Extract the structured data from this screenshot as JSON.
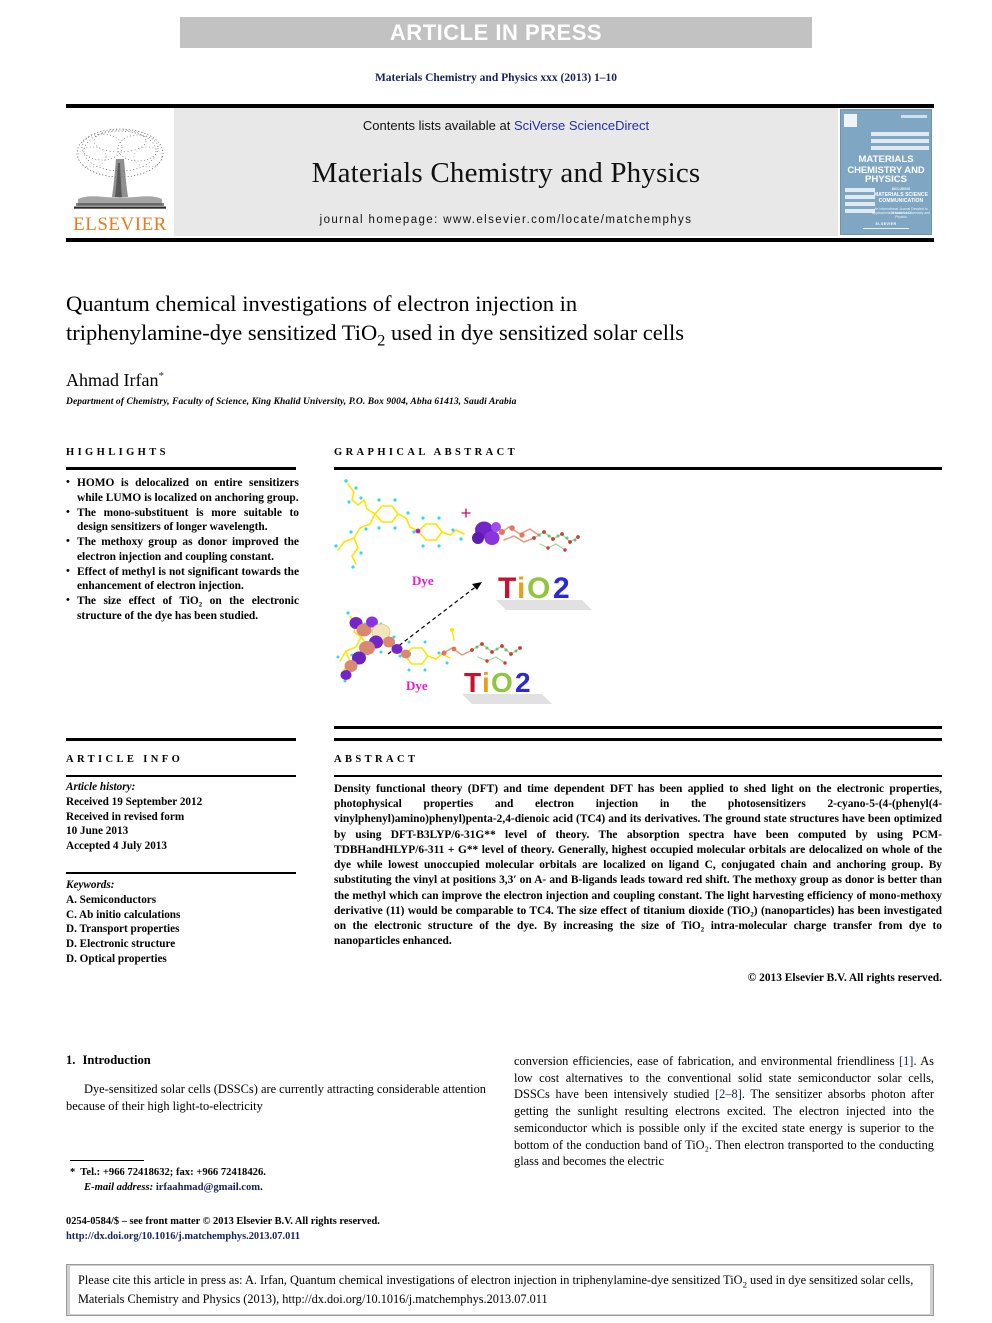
{
  "banner": {
    "text": "ARTICLE IN PRESS"
  },
  "running_head": "Materials Chemistry and Physics xxx (2013) 1–10",
  "masthead": {
    "contents_prefix": "Contents lists available at ",
    "contents_link": "SciVerse ScienceDirect",
    "journal_title": "Materials Chemistry and Physics",
    "homepage": "journal homepage: www.elsevier.com/locate/matchemphys",
    "publisher_wordmark": "ELSEVIER",
    "cover": {
      "line1": "MATERIALS",
      "line2": "CHEMISTRY AND",
      "line3": "PHYSICS",
      "sub1": "INCLUDING",
      "sub2": "MATERIALS SCIENCE",
      "sub3": "COMMUNICATION",
      "fine1": "An International Journal Devoted to Research and",
      "fine2": "Applications of Material Chemistry and Physics",
      "brand": "ELSEVIER"
    }
  },
  "article": {
    "title_line1": "Quantum chemical investigations of electron injection in",
    "title_line2_a": "triphenylamine-dye sensitized TiO",
    "title_line2_sub": "2",
    "title_line2_b": " used in dye sensitized solar cells",
    "author": "Ahmad Irfan",
    "author_marker": "*",
    "affiliation": "Department of Chemistry, Faculty of Science, King Khalid University, P.O. Box 9004, Abha 61413, Saudi Arabia"
  },
  "highlights": {
    "heading": "Highlights",
    "items": [
      "HOMO is delocalized on entire sensitizers while LUMO is localized on anchoring group.",
      "The mono-substituent is more suitable to design sensitizers of longer wavelength.",
      "The methoxy group as donor improved the electron injection and coupling constant.",
      "Effect of methyl is not significant towards the enhancement of electron injection.",
      "The size effect of TiO₂ on the electronic structure of the dye has been studied."
    ]
  },
  "graphical_abstract": {
    "heading": "Graphical abstract",
    "labels": {
      "dye": "Dye",
      "tio2": "TiO2"
    },
    "tio2_letters": [
      {
        "ch": "T",
        "color": "#c9112f"
      },
      {
        "ch": "i",
        "color": "#e8a01c"
      },
      {
        "ch": "O",
        "color": "#8fc63d"
      },
      {
        "ch": "2",
        "color": "#2a2ad6"
      }
    ],
    "dye_color": "#e61ccf"
  },
  "article_info": {
    "heading": "Article info",
    "history_label": "Article history:",
    "history": [
      "Received 19 September 2012",
      "Received in revised form",
      "10 June 2013",
      "Accepted 4 July 2013"
    ],
    "keywords_label": "Keywords:",
    "keywords": [
      "A. Semiconductors",
      "C. Ab initio calculations",
      "D. Transport properties",
      "D. Electronic structure",
      "D. Optical properties"
    ]
  },
  "abstract": {
    "heading": "Abstract",
    "paragraph": "Density functional theory (DFT) and time dependent DFT has been applied to shed light on the electronic properties, photophysical properties and electron injection in the photosensitizers 2-cyano-5-(4-(phenyl(4-vinylphenyl)amino)phenyl)penta-2,4-dienoic acid (TC4) and its derivatives. The ground state structures have been optimized by using DFT-B3LYP/6-31G** level of theory. The absorption spectra have been computed by using PCM-TDBHandHLYP/6-311 + G** level of theory. Generally, highest occupied molecular orbitals are delocalized on whole of the dye while lowest unoccupied molecular orbitals are localized on ligand C, conjugated chain and anchoring group. By substituting the vinyl at positions 3,3′ on A- and B-ligands leads toward red shift. The methoxy group as donor is better than the methyl which can improve the electron injection and coupling constant. The light harvesting efficiency of mono-methoxy derivative (11) would be comparable to TC4. The size effect of titanium dioxide (TiO₂) (nanoparticles) has been investigated on the electronic structure of the dye. By increasing the size of TiO₂ intra-molecular charge transfer from dye to nanoparticles enhanced.",
    "copyright": "© 2013 Elsevier B.V. All rights reserved."
  },
  "body": {
    "section_number": "1.",
    "section_title": "Introduction",
    "left_paragraph": "Dye-sensitized solar cells (DSSCs) are currently attracting considerable attention because of their high light-to-electricity",
    "right_paragraph_1": "conversion efficiencies, ease of fabrication, and environmental friendliness ",
    "right_ref_1": "[1]",
    "right_paragraph_2": ". As low cost alternatives to the conventional solid state semiconductor solar cells, DSSCs have been intensively studied ",
    "right_ref_2": "[2–8]",
    "right_paragraph_3": ". The sensitizer absorbs photon after getting the sunlight resulting electrons excited. The electron injected into the semiconductor which is possible only if the excited state energy is superior to the bottom of the conduction band of TiO₂. Then electron transported to the conducting glass and becomes the electric"
  },
  "footnote": {
    "marker": "*",
    "contact": "Tel.: +966 72418632; fax: +966 72418426.",
    "email_label": "E-mail address:",
    "email": "irfaahmad@gmail.com"
  },
  "imprint": {
    "line1": "0254-0584/$ – see front matter © 2013 Elsevier B.V. All rights reserved.",
    "doi": "http://dx.doi.org/10.1016/j.matchemphys.2013.07.011"
  },
  "cite_box": {
    "text_a": "Please cite this article in press as: A. Irfan, Quantum chemical investigations of electron injection in triphenylamine-dye sensitized TiO",
    "text_sub": "2",
    "text_b": " used in dye sensitized solar cells, Materials Chemistry and Physics (2013), http://dx.doi.org/10.1016/j.matchemphys.2013.07.011"
  },
  "colors": {
    "banner_bg": "#c2c2c2",
    "masthead_bg": "#e8e8e8",
    "link_blue": "#2030aa",
    "navy": "#16235c",
    "elsevier_orange": "#e87b1e",
    "cover_blue": "#7fa7c4",
    "cite_border": "#9a9a9a"
  }
}
